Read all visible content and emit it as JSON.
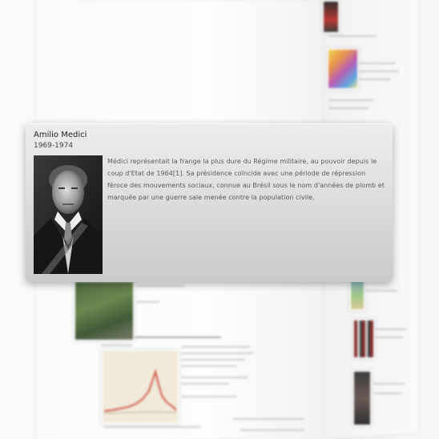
{
  "popup": {
    "name": "Amilio Medici",
    "dates": "1969-1974",
    "description": "Médici représentait la frange la plus dure du Régime militaire, au pouvoir depuis le coup d'Etat de 1964[1]. Sa présidence coïncide avec une période de répression féroce des mouvements sociaux, connue au Brésil sous le nom d'années de plomb et marquée par une guerre sale menée contre la population civile.",
    "portrait_icon": "portrait-photo"
  }
}
